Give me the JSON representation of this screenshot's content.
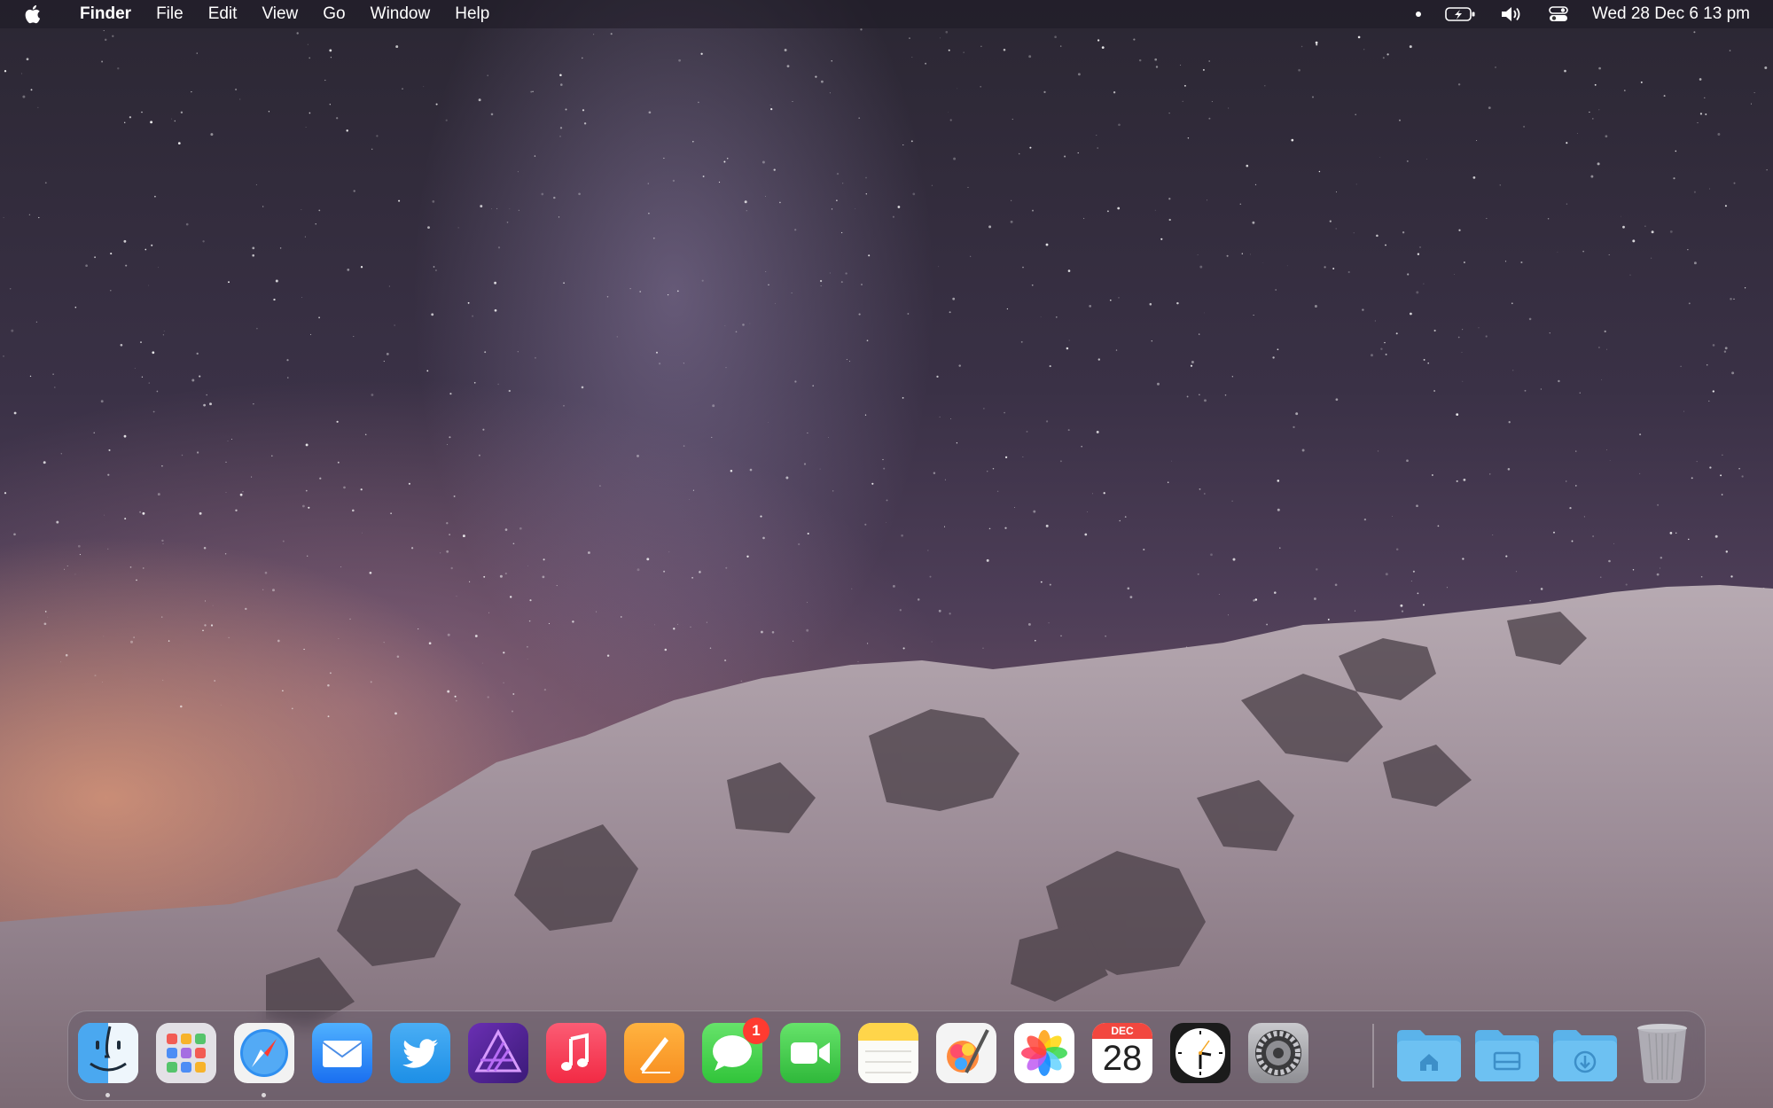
{
  "menubar": {
    "app_name": "Finder",
    "menus": [
      "File",
      "Edit",
      "View",
      "Go",
      "Window",
      "Help"
    ],
    "status_icons": [
      "recording-dot-icon",
      "battery-charging-icon",
      "volume-icon",
      "control-center-icon"
    ],
    "datetime": "Wed 28 Dec  6 13 pm"
  },
  "dock": {
    "apps": [
      {
        "name": "Finder",
        "icon": "finder-icon",
        "running": true
      },
      {
        "name": "Launchpad",
        "icon": "launchpad-icon",
        "running": false
      },
      {
        "name": "Safari",
        "icon": "safari-icon",
        "running": true
      },
      {
        "name": "Mail",
        "icon": "mail-icon",
        "running": false
      },
      {
        "name": "Twitter",
        "icon": "twitter-icon",
        "running": false
      },
      {
        "name": "Affinity Photo",
        "icon": "affinity-icon",
        "running": false
      },
      {
        "name": "Music",
        "icon": "music-icon",
        "running": false
      },
      {
        "name": "Pages",
        "icon": "pages-icon",
        "running": false
      },
      {
        "name": "Messages",
        "icon": "messages-icon",
        "running": false,
        "badge": "1"
      },
      {
        "name": "FaceTime",
        "icon": "facetime-icon",
        "running": false
      },
      {
        "name": "Notes",
        "icon": "notes-icon",
        "running": false
      },
      {
        "name": "Pixelmator Pro",
        "icon": "pixelmator-icon",
        "running": false
      },
      {
        "name": "Photos",
        "icon": "photos-icon",
        "running": false
      },
      {
        "name": "Calendar",
        "icon": "calendar-icon",
        "running": false,
        "month": "DEC",
        "day": "28"
      },
      {
        "name": "Clock",
        "icon": "clock-icon",
        "running": false
      },
      {
        "name": "System Settings",
        "icon": "settings-icon",
        "running": false
      }
    ],
    "folders": [
      {
        "name": "Home",
        "icon": "home-folder-icon"
      },
      {
        "name": "Applications",
        "icon": "applications-folder-icon"
      },
      {
        "name": "Downloads",
        "icon": "downloads-folder-icon"
      }
    ],
    "trash": {
      "name": "Trash",
      "icon": "trash-icon"
    }
  },
  "colors": {
    "badge": "#ff3b30",
    "folder": "#5bb3ea"
  }
}
